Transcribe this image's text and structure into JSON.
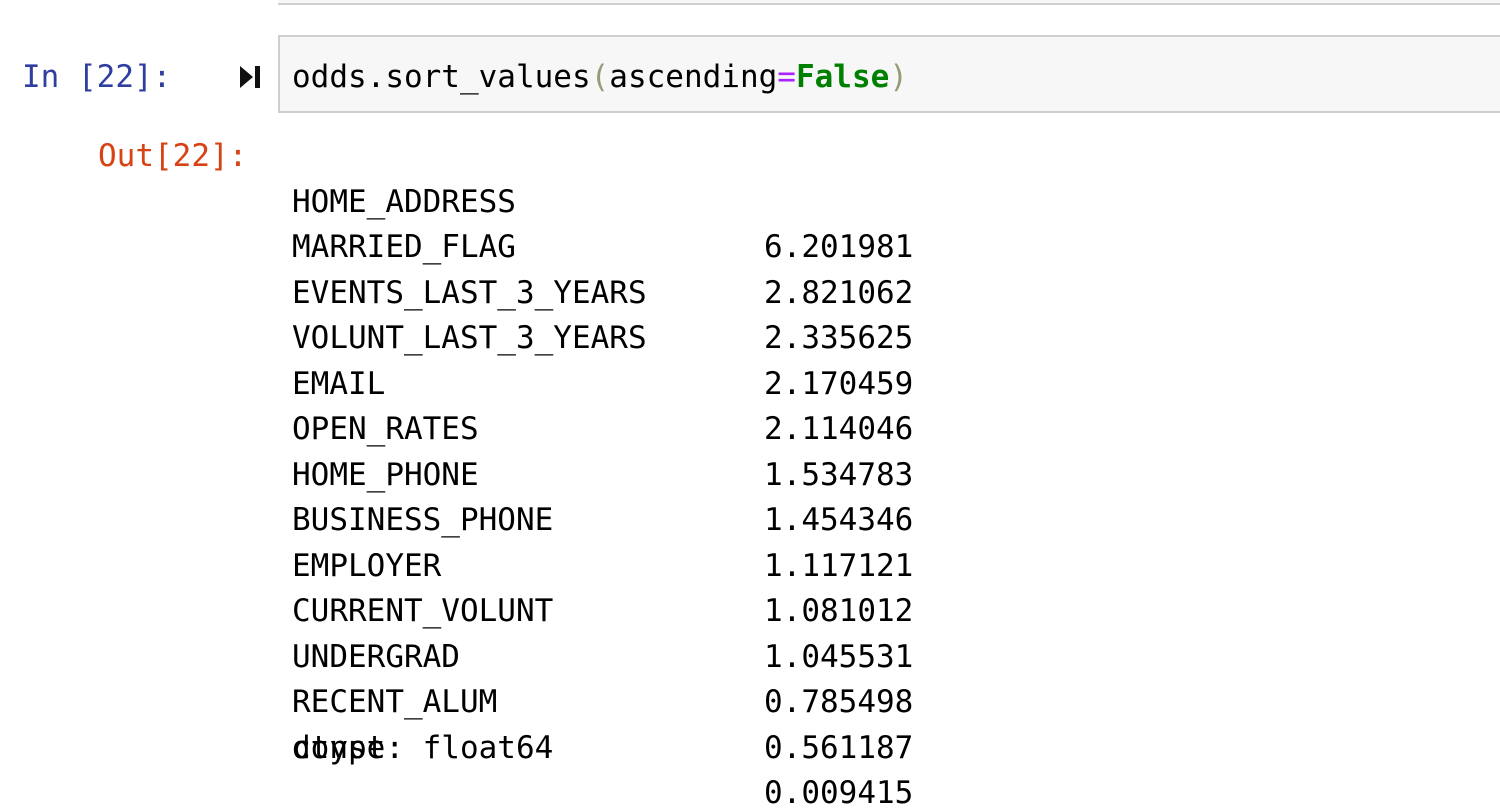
{
  "cell": {
    "in_prompt": "In [22]:",
    "run_icon": "run-cell-icon",
    "code": {
      "obj": "odds.sort_values",
      "open_paren": "(",
      "arg_name": "ascending",
      "operator": "=",
      "arg_value": "False",
      "close_paren": ")"
    }
  },
  "output": {
    "out_prompt": "Out[22]:",
    "rows": [
      {
        "name": "HOME_ADDRESS",
        "value": "6.201981"
      },
      {
        "name": "MARRIED_FLAG",
        "value": "2.821062"
      },
      {
        "name": "EVENTS_LAST_3_YEARS",
        "value": "2.335625"
      },
      {
        "name": "VOLUNT_LAST_3_YEARS",
        "value": "2.170459"
      },
      {
        "name": "EMAIL",
        "value": "2.114046"
      },
      {
        "name": "OPEN_RATES",
        "value": "1.534783"
      },
      {
        "name": "HOME_PHONE",
        "value": "1.454346"
      },
      {
        "name": "BUSINESS_PHONE",
        "value": "1.117121"
      },
      {
        "name": "EMPLOYER",
        "value": "1.081012"
      },
      {
        "name": "CURRENT_VOLUNT",
        "value": "1.045531"
      },
      {
        "name": "UNDERGRAD",
        "value": "0.785498"
      },
      {
        "name": "RECENT_ALUM",
        "value": "0.561187"
      },
      {
        "name": "const",
        "value": "0.009415"
      }
    ],
    "dtype": "dtype: float64"
  },
  "colors": {
    "in_prompt": "#303f9f",
    "out_prompt": "#d84315",
    "keyword": "#008000",
    "operator": "#aa22ff",
    "cell_background": "#f7f7f7",
    "cell_border": "#cfcfcf"
  }
}
